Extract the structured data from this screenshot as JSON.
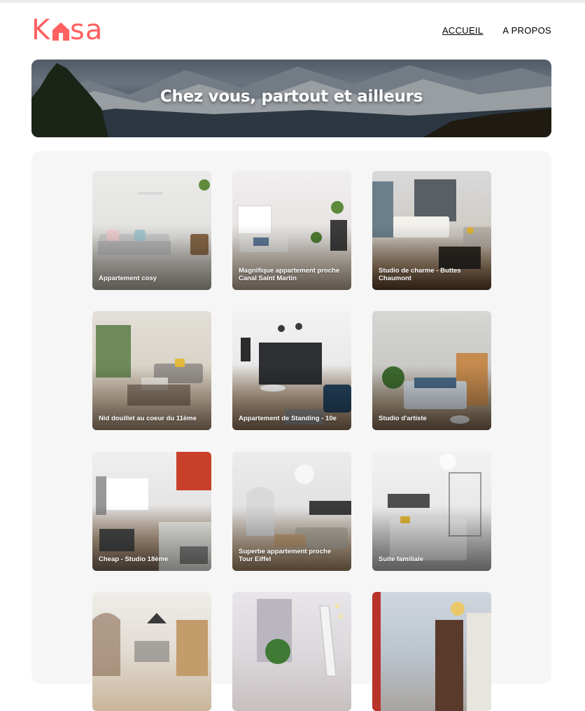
{
  "brand": {
    "logo_left": "K",
    "logo_right": "sa",
    "color": "#ff6060"
  },
  "nav": {
    "items": [
      {
        "label": "ACCUEIL",
        "active": true
      },
      {
        "label": "A PROPOS",
        "active": false
      }
    ]
  },
  "banner": {
    "title": "Chez vous, partout et ailleurs"
  },
  "listings": [
    {
      "title": "Appartement cosy"
    },
    {
      "title": "Magnifique appartement proche Canal Saint Martin"
    },
    {
      "title": "Studio de charme - Buttes Chaumont"
    },
    {
      "title": "Nid douillet au coeur du 11ème"
    },
    {
      "title": "Appartement de Standing - 10e"
    },
    {
      "title": "Studio d'artiste"
    },
    {
      "title": "Cheap - Studio 18ème"
    },
    {
      "title": "Superbe appartement proche Tour Eiffel"
    },
    {
      "title": "Suite familiale"
    },
    {
      "title": ""
    },
    {
      "title": ""
    },
    {
      "title": ""
    }
  ]
}
